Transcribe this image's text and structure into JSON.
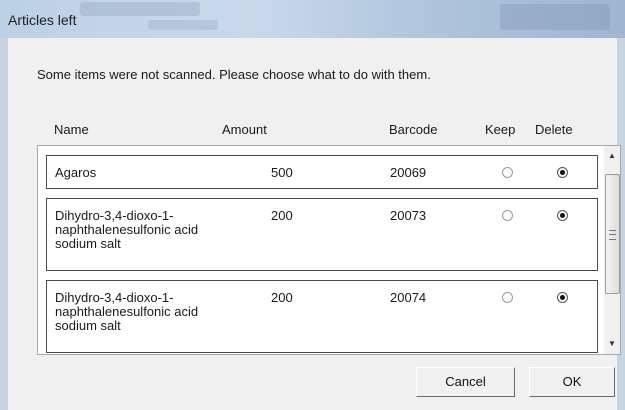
{
  "window": {
    "title": "Articles left"
  },
  "dialog": {
    "instruction": "Some items were not scanned. Please choose what to do with them.",
    "columns": {
      "name": "Name",
      "amount": "Amount",
      "barcode": "Barcode",
      "keep": "Keep",
      "delete": "Delete"
    },
    "rows": [
      {
        "name": "Agaros",
        "amount": "500",
        "barcode": "20069",
        "choice": "delete"
      },
      {
        "name": "Dihydro-3,4-dioxo-1-\nnaphthalenesulfonic acid\nsodium salt",
        "amount": "200",
        "barcode": "20073",
        "choice": "delete"
      },
      {
        "name": "Dihydro-3,4-dioxo-1-\nnaphthalenesulfonic acid\nsodium salt",
        "amount": "200",
        "barcode": "20074",
        "choice": "delete"
      }
    ],
    "scrollbar": {
      "up_icon": "arrow-up-icon",
      "down_icon": "arrow-down-icon"
    },
    "buttons": {
      "cancel": "Cancel",
      "ok": "OK"
    }
  }
}
